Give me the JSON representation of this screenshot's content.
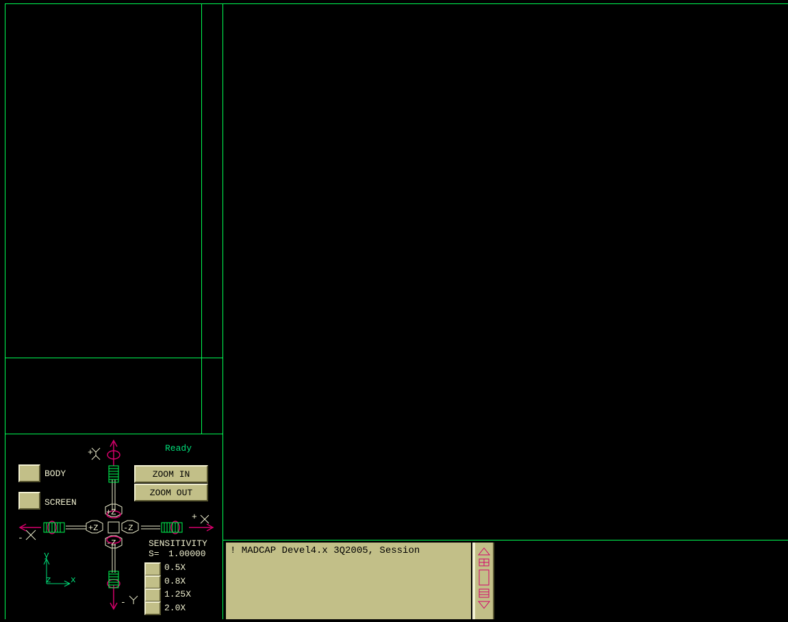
{
  "status": "Ready",
  "mode_buttons": {
    "body": "BODY",
    "screen": "SCREEN"
  },
  "zoom": {
    "in": "ZOOM IN",
    "out": "ZOOM OUT"
  },
  "axes": {
    "plus_y": "+",
    "minus_y": "-",
    "plus_x": "+",
    "minus_x": "-",
    "plus_z": "+Z",
    "minus_z": "-Z"
  },
  "triad": {
    "y": "y",
    "z": "z",
    "x": "x"
  },
  "sensitivity": {
    "title": "SENSITIVITY",
    "value_label": "S=",
    "value": "1.00000",
    "options": [
      "0.5X",
      "0.8X",
      "1.25X",
      "2.0X"
    ]
  },
  "console": {
    "text": "! MADCAP Devel4.x 3Q2005, Session"
  },
  "colors": {
    "frame": "#00ff55",
    "button": "#c2bf88",
    "accent": "#d4006a",
    "status": "#00e07a"
  }
}
